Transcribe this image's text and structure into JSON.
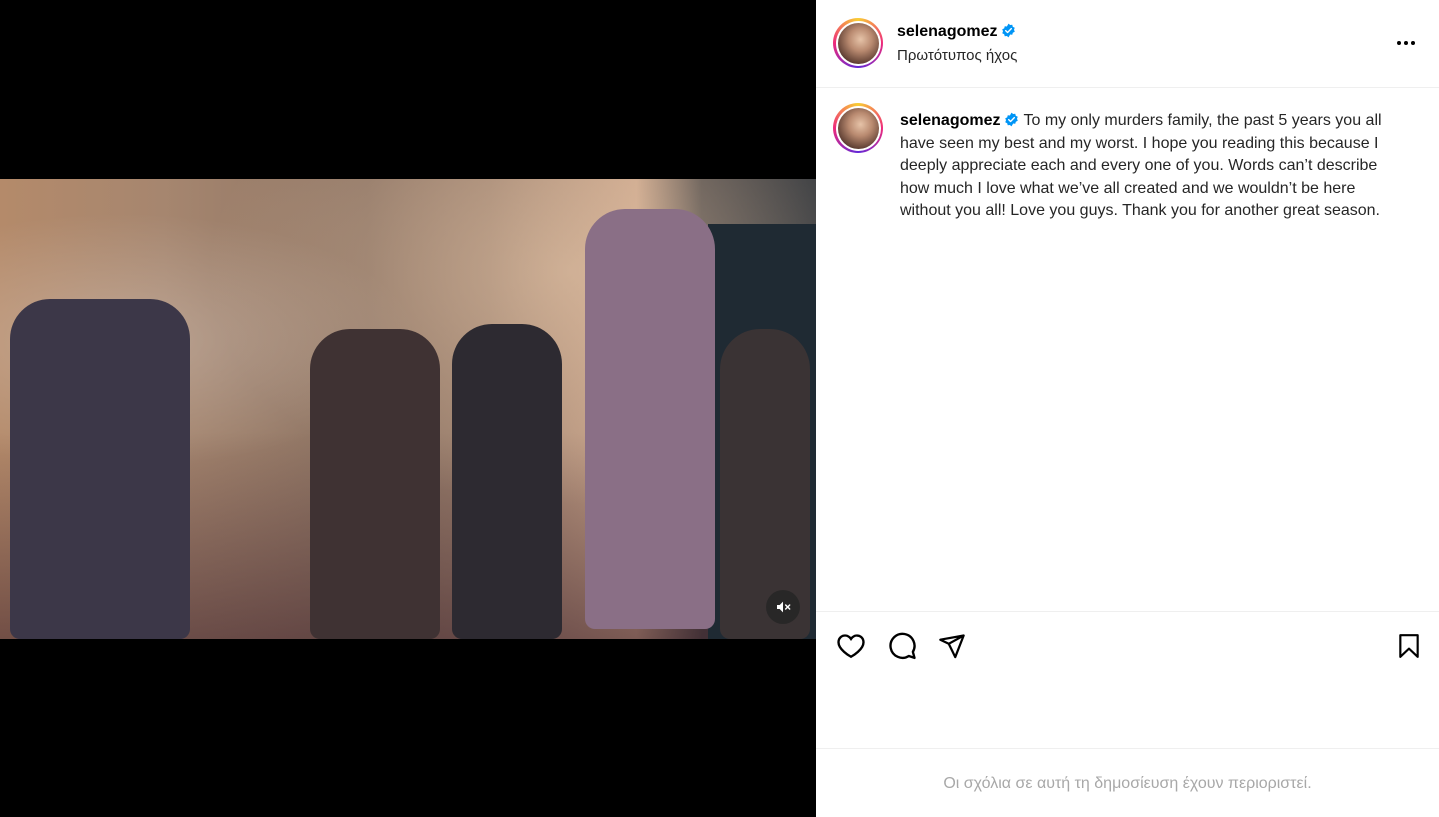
{
  "post": {
    "username": "selenagomez",
    "audio_label": "Πρωτότυπος ήχος",
    "caption": "To my only murders family, the past 5 years you all have seen my best and my worst. I hope you reading this because I deeply appreciate each and every one of you. Words can’t describe how much I love what we’ve all created and we wouldn’t be here without you all! Love you guys. Thank you for another great season.",
    "comments_notice": "Οι σχόλια σε αυτή τη δημοσίευση έχουν περιοριστεί."
  },
  "media": {
    "muted": true
  },
  "colors": {
    "verified": "#0095f6",
    "muted_text": "#a8a8a8",
    "divider": "#efefef"
  },
  "icons": {
    "verified": "verified-badge-icon",
    "more": "more-options-icon",
    "like": "heart-icon",
    "comment": "comment-icon",
    "share": "share-icon",
    "save": "bookmark-icon",
    "mute": "speaker-muted-icon"
  }
}
